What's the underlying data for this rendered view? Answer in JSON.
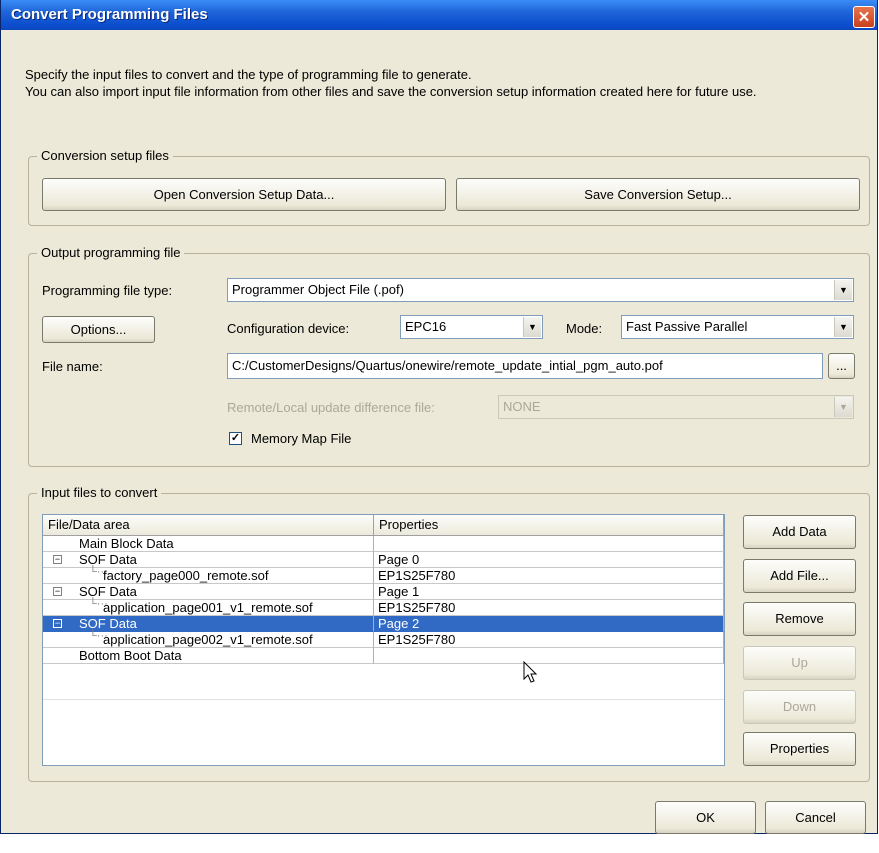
{
  "window": {
    "title": "Convert Programming Files",
    "close_glyph": "✕"
  },
  "intro": {
    "line1": "Specify the input files to convert and the type of programming file to generate.",
    "line2": "You can also import input file information from other files and save the conversion setup information created here for future use."
  },
  "conversion_setup": {
    "legend": "Conversion setup files",
    "open_label": "Open Conversion Setup Data...",
    "save_label": "Save Conversion Setup..."
  },
  "output": {
    "legend": "Output programming file",
    "file_type_label": "Programming file type:",
    "file_type_value": "Programmer Object File (.pof)",
    "options_label": "Options...",
    "config_device_label": "Configuration device:",
    "config_device_value": "EPC16",
    "mode_label": "Mode:",
    "mode_value": "Fast Passive Parallel",
    "file_name_label": "File name:",
    "file_name_value": "C:/CustomerDesigns/Quartus/onewire/remote_update_intial_pgm_auto.pof",
    "browse_label": "...",
    "remote_label": "Remote/Local update difference file:",
    "remote_value": "NONE",
    "memory_map_label": "Memory Map File",
    "memory_map_checked": true
  },
  "input": {
    "legend": "Input files to convert",
    "columns": [
      "File/Data area",
      "Properties"
    ],
    "rows": [
      {
        "name": "Main Block Data",
        "prop": ""
      },
      {
        "name": "SOF Data",
        "prop": "Page 0"
      },
      {
        "name": "factory_page000_remote.sof",
        "prop": "EP1S25F780"
      },
      {
        "name": "SOF Data",
        "prop": "Page 1"
      },
      {
        "name": "application_page001_v1_remote.sof",
        "prop": "EP1S25F780"
      },
      {
        "name": "SOF Data",
        "prop": "Page 2"
      },
      {
        "name": "application_page002_v1_remote.sof",
        "prop": "EP1S25F780"
      },
      {
        "name": "Bottom Boot Data",
        "prop": ""
      }
    ],
    "expand_glyph": "−",
    "selected_row": 6,
    "buttons": {
      "add_data": "Add Data",
      "add_file": "Add File...",
      "remove": "Remove",
      "up": "Up",
      "down": "Down",
      "properties": "Properties"
    }
  },
  "footer": {
    "ok": "OK",
    "cancel": "Cancel"
  }
}
